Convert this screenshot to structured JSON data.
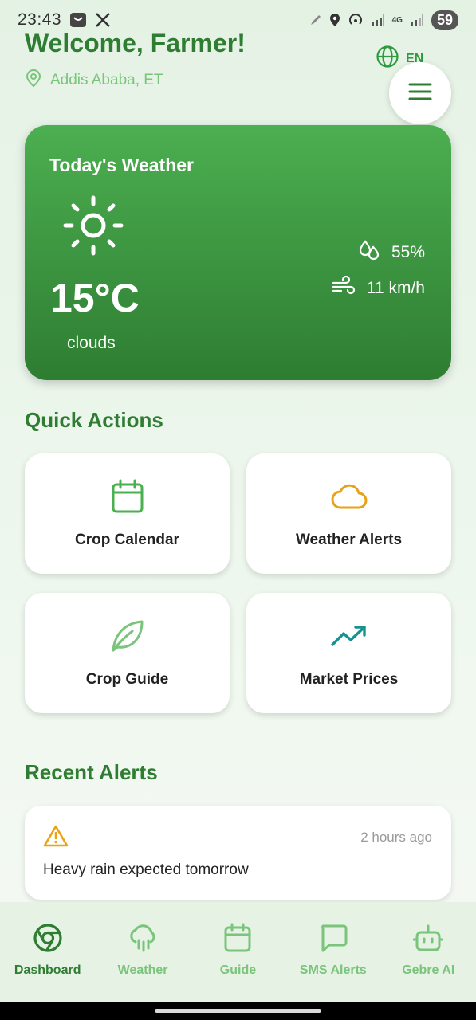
{
  "status_bar": {
    "time": "23:43",
    "network": "4G",
    "battery": "59"
  },
  "header": {
    "title": "Welcome, Farmer!",
    "location": "Addis Ababa, ET",
    "language": "EN"
  },
  "weather": {
    "title": "Today's Weather",
    "temperature": "15°C",
    "condition": "clouds",
    "humidity": "55%",
    "wind": "11 km/h"
  },
  "quick_actions": {
    "title": "Quick Actions",
    "items": [
      {
        "label": "Crop Calendar",
        "icon": "calendar-icon"
      },
      {
        "label": "Weather Alerts",
        "icon": "cloud-icon"
      },
      {
        "label": "Crop Guide",
        "icon": "leaf-icon"
      },
      {
        "label": "Market Prices",
        "icon": "trending-up-icon"
      }
    ]
  },
  "recent_alerts": {
    "title": "Recent Alerts",
    "items": [
      {
        "time": "2 hours ago",
        "message": "Heavy rain expected tomorrow"
      }
    ]
  },
  "bottom_nav": {
    "items": [
      {
        "label": "Dashboard",
        "icon": "dashboard-icon",
        "active": true
      },
      {
        "label": "Weather",
        "icon": "rain-cloud-icon",
        "active": false
      },
      {
        "label": "Guide",
        "icon": "calendar-icon",
        "active": false
      },
      {
        "label": "SMS Alerts",
        "icon": "message-icon",
        "active": false
      },
      {
        "label": "Gebre AI",
        "icon": "robot-icon",
        "active": false
      }
    ]
  },
  "colors": {
    "primary": "#2e7d32",
    "accent_light": "#7ac47c",
    "warning": "#e8a317",
    "teal": "#17928f"
  }
}
